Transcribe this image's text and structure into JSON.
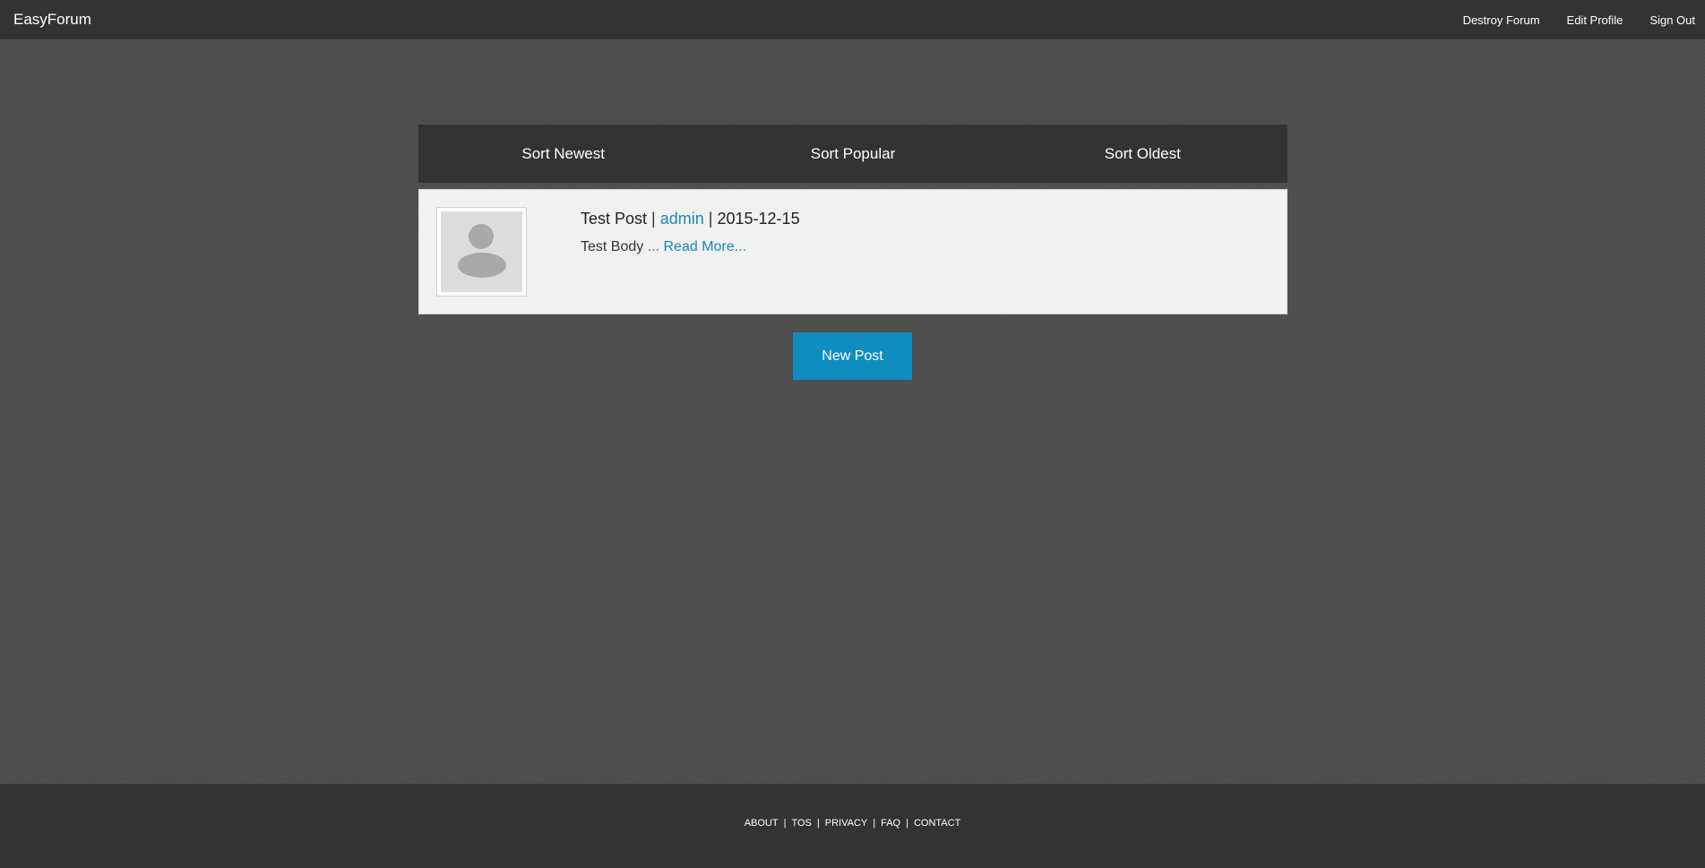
{
  "header": {
    "brand": "EasyForum",
    "nav": {
      "destroy": "Destroy Forum",
      "edit_profile": "Edit Profile",
      "sign_out": "Sign Out"
    }
  },
  "sort_bar": {
    "newest": "Sort Newest",
    "popular": "Sort Popular",
    "oldest": "Sort Oldest"
  },
  "posts": [
    {
      "title": "Test Post",
      "separator": "|",
      "author": "admin",
      "date": "2015-12-15",
      "body": "Test Body",
      "read_more": "... Read More..."
    }
  ],
  "new_post_button": "New Post",
  "footer": {
    "about": "ABOUT",
    "tos": "TOS",
    "privacy": "PRIVACY",
    "faq": "FAQ",
    "contact": "CONTACT",
    "separator": "|"
  },
  "colors": {
    "bar": "#333333",
    "background": "#4f4f4f",
    "card": "#f1f1f1",
    "accent": "#0f8dc0",
    "link": "#1a86b8"
  }
}
